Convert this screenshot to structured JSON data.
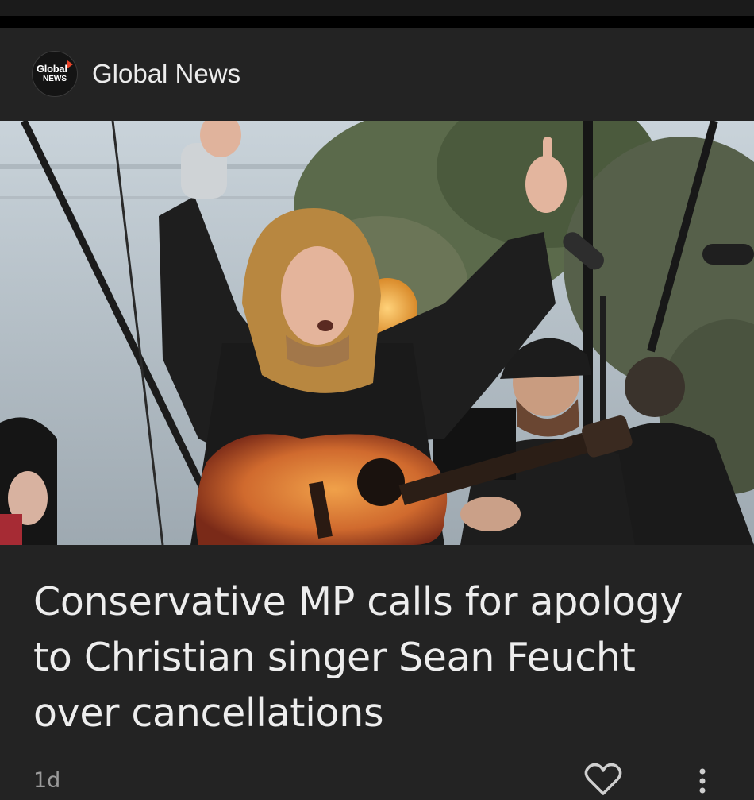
{
  "source": {
    "logo_text_top": "Global",
    "logo_text_bottom": "NEWS",
    "name": "Global News"
  },
  "article": {
    "headline": "Conservative MP calls for apology to Christian singer Sean Feucht over cancellations",
    "age": "1d",
    "image_subject": "Singer with curly hair, arms raised, playing acoustic guitar on an outdoor stage with microphones"
  },
  "actions": {
    "like_icon": "heart-outline-icon",
    "more_icon": "vertical-ellipsis-icon"
  },
  "colors": {
    "background": "#232323",
    "text_primary": "#ededed",
    "text_secondary": "#9a9a9a",
    "logo_accent": "#e8442a"
  }
}
